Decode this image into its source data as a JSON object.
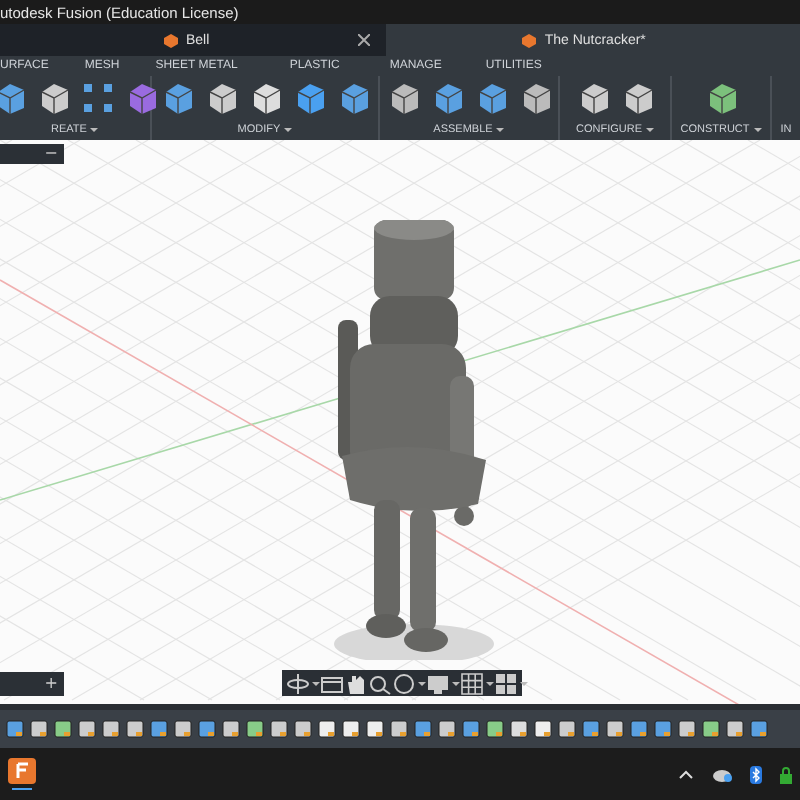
{
  "window": {
    "title": "utodesk Fusion (Education License)"
  },
  "document_tabs": [
    {
      "label": "Bell",
      "selected": false,
      "closable": true
    },
    {
      "label": "The Nutcracker*",
      "selected": true,
      "closable": false
    }
  ],
  "ribbon_tabs": [
    "URFACE",
    "MESH",
    "SHEET METAL",
    "PLASTIC",
    "MANAGE",
    "UTILITIES"
  ],
  "ribbon_groups": [
    {
      "label": "REATE",
      "dropdown": true
    },
    {
      "label": "MODIFY",
      "dropdown": true
    },
    {
      "label": "ASSEMBLE",
      "dropdown": true
    },
    {
      "label": "CONFIGURE",
      "dropdown": true
    },
    {
      "label": "CONSTRUCT",
      "dropdown": true
    },
    {
      "label": "IN",
      "dropdown": false
    }
  ],
  "browser_panel": {
    "button": "−"
  },
  "comments_panel": {
    "button": "+"
  }
}
